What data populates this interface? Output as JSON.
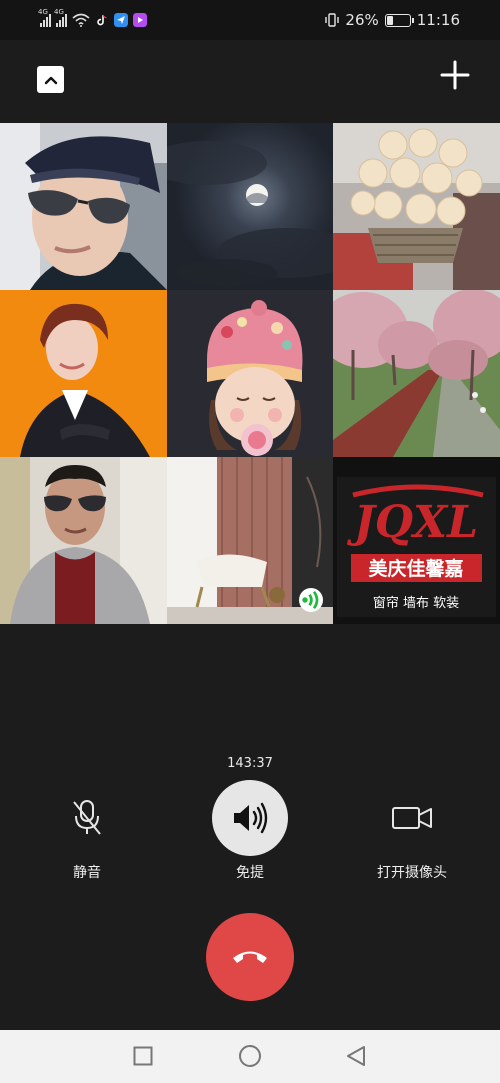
{
  "status_bar": {
    "network_tag_1": "4G",
    "network_tag_2": "4G",
    "battery": "26%",
    "battery_level": 0.26,
    "time": "11:16"
  },
  "icons": {
    "collapse": "chevron-up-icon",
    "add": "plus-icon",
    "mute": "microphone-off-icon",
    "speaker": "speaker-icon",
    "camera": "video-camera-icon",
    "hangup": "phone-hangup-icon",
    "speaking": "audio-wave-icon"
  },
  "participants": [
    {
      "id": "p1",
      "name": ""
    },
    {
      "id": "p2",
      "name": ""
    },
    {
      "id": "p3",
      "name": ""
    },
    {
      "id": "p4",
      "name": ""
    },
    {
      "id": "p5",
      "name": ""
    },
    {
      "id": "p6",
      "name": ""
    },
    {
      "id": "p7",
      "name": "",
      "speaking": true
    },
    {
      "id": "p8",
      "name": "",
      "logo_text_main": "JQXL",
      "logo_text_cn": "美庆佳馨嘉",
      "logo_text_sub": "窗帘 墙布 软装"
    }
  ],
  "call": {
    "duration": "143:37",
    "mute_label": "静音",
    "speaker_label": "免提",
    "camera_label": "打开摄像头",
    "speaker_active": true
  },
  "colors": {
    "background": "#1c1c1c",
    "hangup": "#e04848",
    "speaker_active_bg": "#e6e6e6"
  }
}
